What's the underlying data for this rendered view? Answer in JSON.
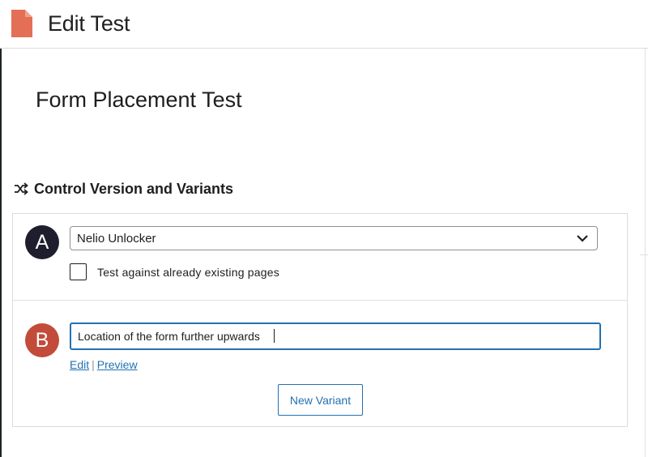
{
  "header": {
    "title": "Edit Test",
    "icon": "document-icon",
    "icon_color": "#e26f56"
  },
  "test": {
    "title": "Form Placement Test"
  },
  "section": {
    "icon": "shuffle-icon",
    "title": "Control Version and Variants"
  },
  "control": {
    "avatar_letter": "A",
    "avatar_color": "#1e1e2e",
    "select_value": "Nelio Unlocker",
    "checkbox_label": "Test against already existing pages",
    "checkbox_checked": false
  },
  "variant": {
    "avatar_letter": "B",
    "avatar_color": "#c34b39",
    "input_value": "Location of the form further upwards",
    "edit_label": "Edit",
    "separator": "|",
    "preview_label": "Preview"
  },
  "actions": {
    "new_variant_label": "New Variant"
  },
  "colors": {
    "accent": "#2271b1",
    "border": "#dcdcde"
  }
}
